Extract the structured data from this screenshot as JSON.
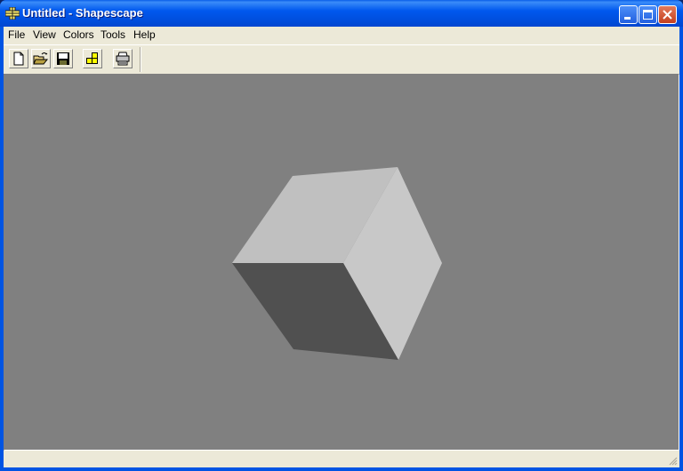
{
  "window": {
    "title": "Untitled - Shapescape",
    "app_icon": "shapescape-app-icon",
    "controls": [
      "minimize",
      "maximize",
      "close"
    ]
  },
  "menubar": {
    "items": [
      {
        "label": "File"
      },
      {
        "label": "View"
      },
      {
        "label": "Colors"
      },
      {
        "label": "Tools"
      },
      {
        "label": "Help"
      }
    ]
  },
  "toolbar": {
    "buttons": [
      {
        "icon": "new-document-icon",
        "tooltip": "New"
      },
      {
        "icon": "open-folder-icon",
        "tooltip": "Open"
      },
      {
        "icon": "save-disk-icon",
        "tooltip": "Save"
      },
      {
        "icon": "shapes-blocks-icon",
        "tooltip": "Shapes"
      },
      {
        "icon": "printer-icon",
        "tooltip": "Print"
      }
    ]
  },
  "canvas": {
    "background_color": "#808080",
    "shape": {
      "type": "cube",
      "face_colors": {
        "top": "#c0c0c0",
        "right": "#c8c8c8",
        "front": "#505050"
      }
    }
  },
  "statusbar": {
    "text": ""
  }
}
